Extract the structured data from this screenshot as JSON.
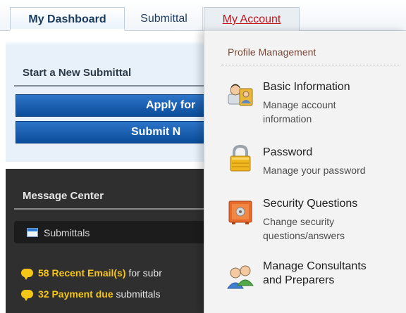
{
  "tabs": [
    {
      "label": "My Dashboard"
    },
    {
      "label": "Submittal"
    },
    {
      "label": "My Account"
    }
  ],
  "left": {
    "start_title": "Start a New Submittal",
    "apply_button": "Apply for",
    "submit_button": "Submit N",
    "message_center_title": "Message Center",
    "submittals_label": "Submittals",
    "messages": [
      {
        "bold": "58 Recent Email(s)",
        "rest": " for subr"
      },
      {
        "bold": "32 Payment due",
        "rest": " submittals"
      }
    ]
  },
  "menu": {
    "header": "Profile Management",
    "items": [
      {
        "title": "Basic Information",
        "sub1": "Manage account",
        "sub2": "information",
        "icon": "user-profile-icon"
      },
      {
        "title": "Password",
        "sub1": "Manage your password",
        "icon": "padlock-icon"
      },
      {
        "title": "Security Questions",
        "sub1": "Change security",
        "sub2": "questions/answers",
        "icon": "safe-icon"
      },
      {
        "title": "Manage Consultants",
        "title2": "and Preparers",
        "icon": "users-group-icon"
      }
    ]
  },
  "colors": {
    "accent_blue": "#0b4d9a",
    "link_red": "#c0151d",
    "message_yellow": "#f5c518",
    "dark_panel": "#2f2f2f"
  }
}
